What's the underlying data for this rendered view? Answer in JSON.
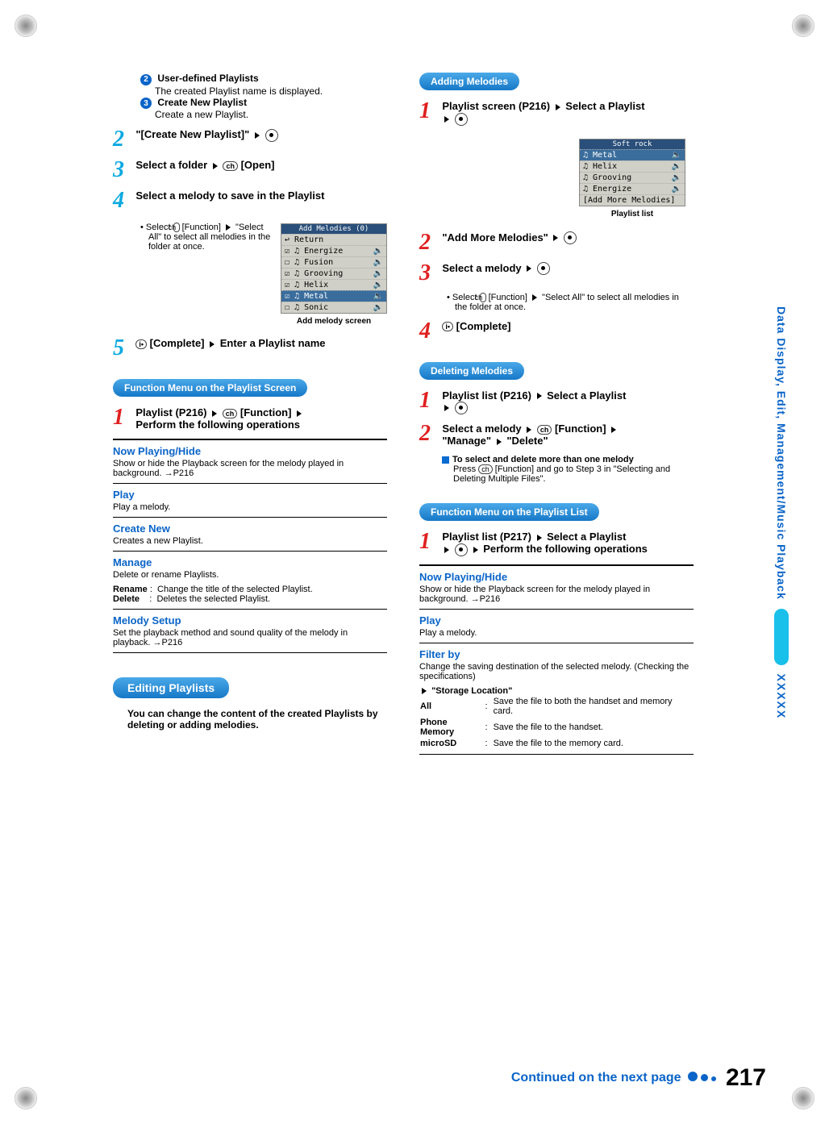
{
  "page_number": "217",
  "continued_text": "Continued on the next page",
  "side_tab": {
    "label": "Data Display, Edit, Management/Music Playback",
    "xs": "XXXXX"
  },
  "col1": {
    "listA": {
      "n2": {
        "title": "User-defined Playlists",
        "desc": "The created Playlist name is displayed."
      },
      "n3": {
        "title": "Create New Playlist",
        "desc": "Create a new Playlist."
      }
    },
    "step2": {
      "num": "2",
      "txt": "\"[Create New Playlist]\" "
    },
    "step3": {
      "num": "3",
      "txt_a": "Select a folder ",
      "key": "ch",
      "txt_b": " [Open]"
    },
    "step4": {
      "num": "4",
      "txt": "Select a melody to save in the Playlist",
      "sub": "Select ",
      "subkey": "ch",
      "sub2": " [Function] ",
      "sub3": " \"Select All\" to select all melodies in the folder at once.",
      "ss_title": "Add Melodies (0)",
      "ss_rows": [
        "↩ Return",
        "☑ ♫ Energize",
        "☐ ♫ Fusion",
        "☑ ♫ Grooving",
        "☑ ♫ Helix",
        "☑ ♫ Metal",
        "☐ ♫ Sonic"
      ],
      "ss_cap": "Add melody screen"
    },
    "step5": {
      "num": "5",
      "key": "i•",
      "txt": " [Complete] ",
      "txt2": " Enter a Playlist name"
    },
    "pill1": "Function Menu on the Playlist Screen",
    "fstep1": {
      "num": "1",
      "line1a": "Playlist (P216) ",
      "key": "ch",
      "line1b": " [Function] ",
      "line2": "Perform the following operations"
    },
    "m1": {
      "h": "Now Playing/Hide",
      "d": "Show or hide the Playback screen for the melody played in background. →P216"
    },
    "m2": {
      "h": "Play",
      "d": "Play a melody."
    },
    "m3": {
      "h": "Create New",
      "d": "Creates a new Playlist."
    },
    "m4": {
      "h": "Manage",
      "d": "Delete or rename Playlists.",
      "r1a": "Rename",
      "r1b": "Change the title of the selected Playlist.",
      "r2a": "Delete",
      "r2b": "Deletes the selected Playlist."
    },
    "m5": {
      "h": "Melody Setup",
      "d": "Set the playback method and sound quality of the melody in playback. →P216"
    },
    "editing_pill": "Editing Playlists",
    "editing_note": "You can change the content of the created Playlists by deleting or adding melodies."
  },
  "col2": {
    "add_pill": "Adding Melodies",
    "a1": {
      "num": "1",
      "txt1": "Playlist screen (P216) ",
      "txt2": " Select a Playlist "
    },
    "ss_title": "Soft rock",
    "ss_rows": [
      "♫ Metal",
      "♫ Helix",
      "♫ Grooving",
      "♫ Energize",
      "[Add More Melodies]"
    ],
    "ss_cap": "Playlist list",
    "a2": {
      "num": "2",
      "txt": "\"Add More Melodies\" "
    },
    "a3": {
      "num": "3",
      "txt": "Select a melody ",
      "sub": "Select ",
      "subkey": "ch",
      "sub2": " [Function] ",
      "sub3": " \"Select All\" to select all melodies in the folder at once."
    },
    "a4": {
      "num": "4",
      "key": "i•",
      "txt": " [Complete]"
    },
    "del_pill": "Deleting Melodies",
    "d1": {
      "num": "1",
      "txt1": "Playlist list (P216) ",
      "txt2": " Select a Playlist "
    },
    "d2": {
      "num": "2",
      "txt1": "Select a melody ",
      "key": "ch",
      "txt2": " [Function] ",
      "txt3": "\"Manage\" ",
      "txt4": " \"Delete\""
    },
    "d_note_h": "To select and delete more than one melody",
    "d_note_b1": "Press ",
    "d_note_key": "ch",
    "d_note_b2": " [Function] and go to Step 3 in \"Selecting and Deleting Multiple Files\".",
    "pill2": "Function Menu on the Playlist List",
    "f2_1": {
      "num": "1",
      "l1": "Playlist list (P217) ",
      "l2": " Select a Playlist ",
      "l3": " Perform the following operations"
    },
    "fm1": {
      "h": "Now Playing/Hide",
      "d": "Show or hide the Playback screen for the melody played in background. →P216"
    },
    "fm2": {
      "h": "Play",
      "d": "Play a melody."
    },
    "fm3": {
      "h": "Filter by",
      "d": "Change the saving destination of the selected melody. (Checking the specifications)",
      "sl": "\"Storage Location\"",
      "r1a": "All",
      "r1b": "Save the file to both the handset and memory card.",
      "r2a": "Phone Memory",
      "r2b": "Save the file to the handset.",
      "r3a": "microSD",
      "r3b": "Save the file to the memory card."
    }
  }
}
